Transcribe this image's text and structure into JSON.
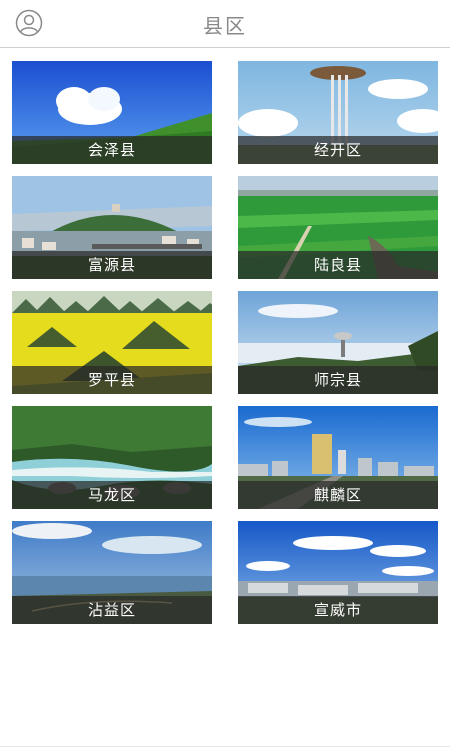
{
  "header": {
    "title": "县区",
    "avatar_icon": "user-avatar-icon"
  },
  "regions": [
    {
      "name": "会泽县"
    },
    {
      "name": "经开区"
    },
    {
      "name": "富源县"
    },
    {
      "name": "陆良县"
    },
    {
      "name": "罗平县"
    },
    {
      "name": "师宗县"
    },
    {
      "name": "马龙区"
    },
    {
      "name": "麒麟区"
    },
    {
      "name": "沾益区"
    },
    {
      "name": "宣威市"
    }
  ],
  "colors": {
    "label_bar": "#282828",
    "header_text": "#888888",
    "divider": "#cfcfcf"
  }
}
